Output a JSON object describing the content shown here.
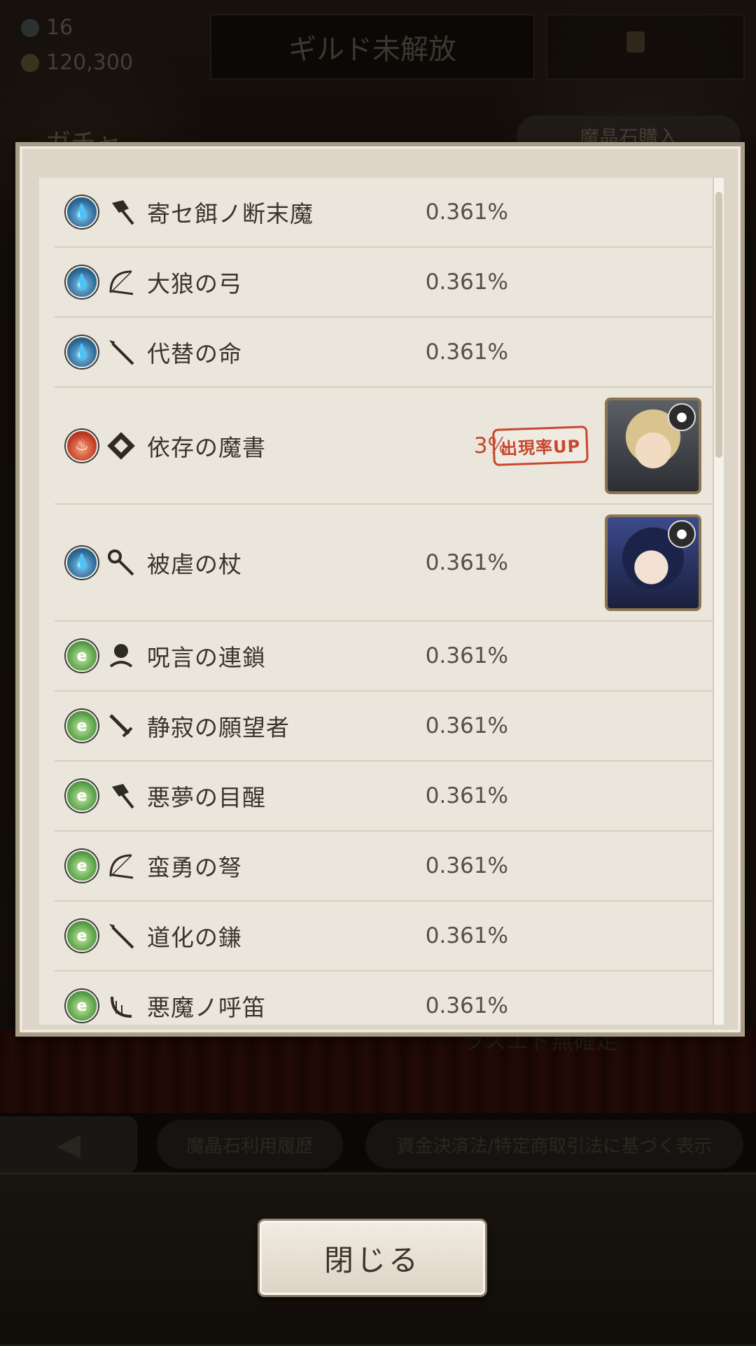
{
  "status": {
    "crystals": "16",
    "gold": "120,300"
  },
  "header": {
    "guild_label": "ギルド未解放",
    "title": "ガチャ",
    "buy_label": "魔晶石購入"
  },
  "behind_text": "ラスエド無確定",
  "bottom_nav": {
    "history_label": "魔晶石利用履歴",
    "legal_label": "資金決済法/特定商取引法に基づく表示"
  },
  "list": [
    {
      "attr": "water",
      "weapon": "hammer",
      "name": "寄セ餌ノ断末魔",
      "rate": "0.361%"
    },
    {
      "attr": "water",
      "weapon": "bow",
      "name": "大狼の弓",
      "rate": "0.361%"
    },
    {
      "attr": "water",
      "weapon": "spear",
      "name": "代替の命",
      "rate": "0.361%"
    },
    {
      "attr": "fire",
      "weapon": "tome",
      "name": "依存の魔書",
      "rate": "3%",
      "badge": "出現率UP",
      "portrait": "p1"
    },
    {
      "attr": "water",
      "weapon": "staff",
      "name": "被虐の杖",
      "rate": "0.361%",
      "portrait": "p2"
    },
    {
      "attr": "wind",
      "weapon": "orb",
      "name": "呪言の連鎖",
      "rate": "0.361%"
    },
    {
      "attr": "wind",
      "weapon": "sword",
      "name": "静寂の願望者",
      "rate": "0.361%"
    },
    {
      "attr": "wind",
      "weapon": "hammer",
      "name": "悪夢の目醒",
      "rate": "0.361%"
    },
    {
      "attr": "wind",
      "weapon": "bow",
      "name": "蛮勇の弩",
      "rate": "0.361%"
    },
    {
      "attr": "wind",
      "weapon": "spear",
      "name": "道化の鎌",
      "rate": "0.361%"
    },
    {
      "attr": "wind",
      "weapon": "harp",
      "name": "悪魔ノ呼笛",
      "rate": "0.361%"
    }
  ],
  "close_label": "閉じる"
}
